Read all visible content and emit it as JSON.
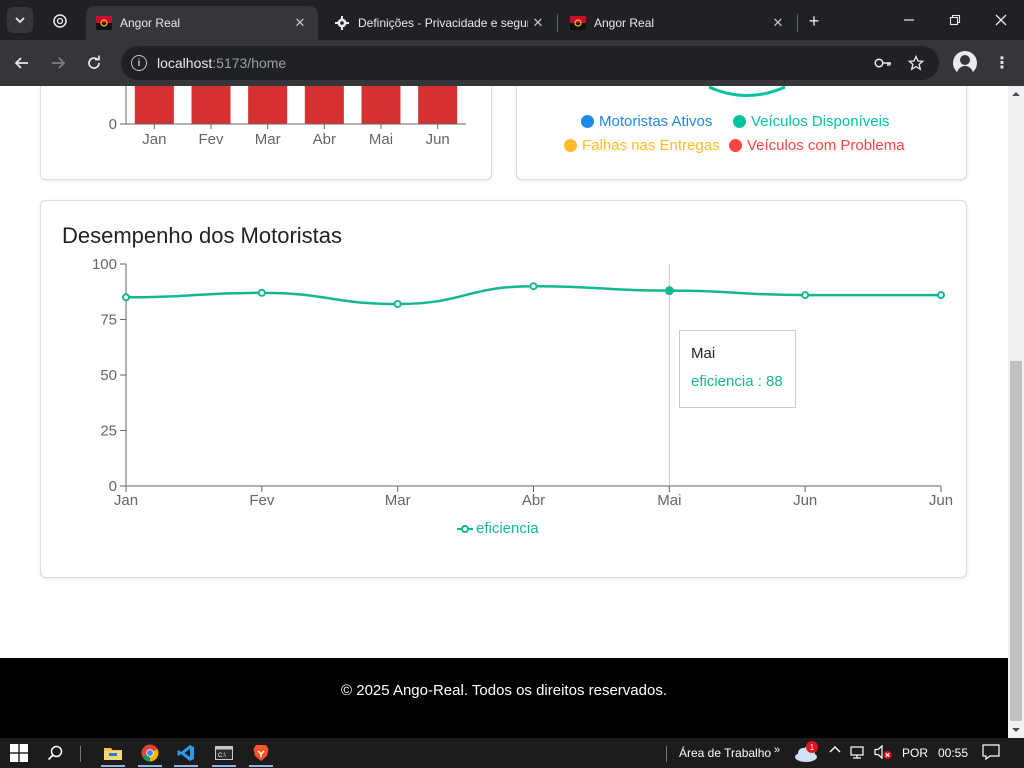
{
  "browser": {
    "tabs": [
      {
        "title": "Angor Real",
        "active": true
      },
      {
        "title": "Definições - Privacidade e segurança",
        "active": false
      },
      {
        "title": "Angor Real",
        "active": false
      }
    ],
    "url_host": "localhost",
    "url_rest": ":5173/home"
  },
  "bar_chart": {
    "chart_data": {
      "type": "bar",
      "categories": [
        "Jan",
        "Fev",
        "Mar",
        "Abr",
        "Mai",
        "Jun"
      ],
      "y_ticks": [
        "0"
      ],
      "bar_color": "#d63031"
    }
  },
  "pie_chart": {
    "legend": [
      {
        "label": "Motoristas Ativos",
        "color": "#1e88e5"
      },
      {
        "label": "Veículos Disponíveis",
        "color": "#00c49f"
      },
      {
        "label": "Falhas nas Entregas",
        "color": "#ffbb28"
      },
      {
        "label": "Veículos com Problema",
        "color": "#ff4444"
      }
    ]
  },
  "line_chart": {
    "title": "Desempenho dos Motoristas",
    "chart_data": {
      "type": "line",
      "categories": [
        "Jan",
        "Fev",
        "Mar",
        "Abr",
        "Mai",
        "Jun",
        "Jun"
      ],
      "series": [
        {
          "name": "eficiencia",
          "color": "#14b890",
          "values": [
            85,
            87,
            82,
            90,
            88,
            86,
            86
          ]
        }
      ],
      "ylim": [
        0,
        100
      ],
      "y_ticks": [
        0,
        25,
        50,
        75,
        100
      ]
    },
    "tooltip": {
      "label": "Mai",
      "value_text": "eficiencia : 88"
    },
    "legend_label": "eficiencia"
  },
  "footer": {
    "text": "© 2025 Ango-Real. Todos os direitos reservados."
  },
  "taskbar": {
    "desktop_label": "Área de Trabalho",
    "language": "POR",
    "time": "00:55",
    "weather_badge": "1"
  }
}
